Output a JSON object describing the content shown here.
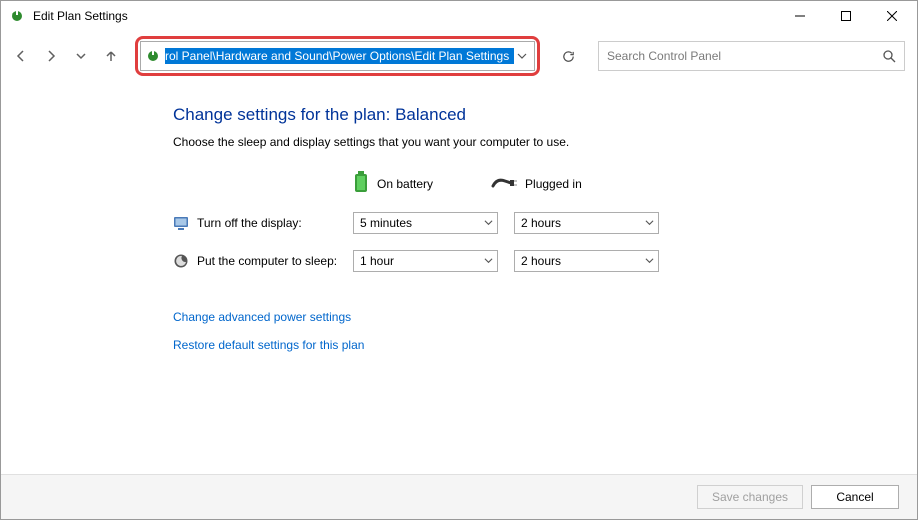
{
  "window": {
    "title": "Edit Plan Settings"
  },
  "address": {
    "path": "rol Panel\\Hardware and Sound\\Power Options\\Edit Plan Settings"
  },
  "search": {
    "placeholder": "Search Control Panel"
  },
  "content": {
    "heading": "Change settings for the plan: Balanced",
    "subtext": "Choose the sleep and display settings that you want your computer to use.",
    "cols": {
      "battery": "On battery",
      "plugged": "Plugged in"
    },
    "rows": {
      "display": {
        "label": "Turn off the display:",
        "battery": "5 minutes",
        "plugged": "2 hours"
      },
      "sleep": {
        "label": "Put the computer to sleep:",
        "battery": "1 hour",
        "plugged": "2 hours"
      }
    },
    "links": {
      "advanced": "Change advanced power settings",
      "restore": "Restore default settings for this plan"
    }
  },
  "footer": {
    "save": "Save changes",
    "cancel": "Cancel"
  }
}
